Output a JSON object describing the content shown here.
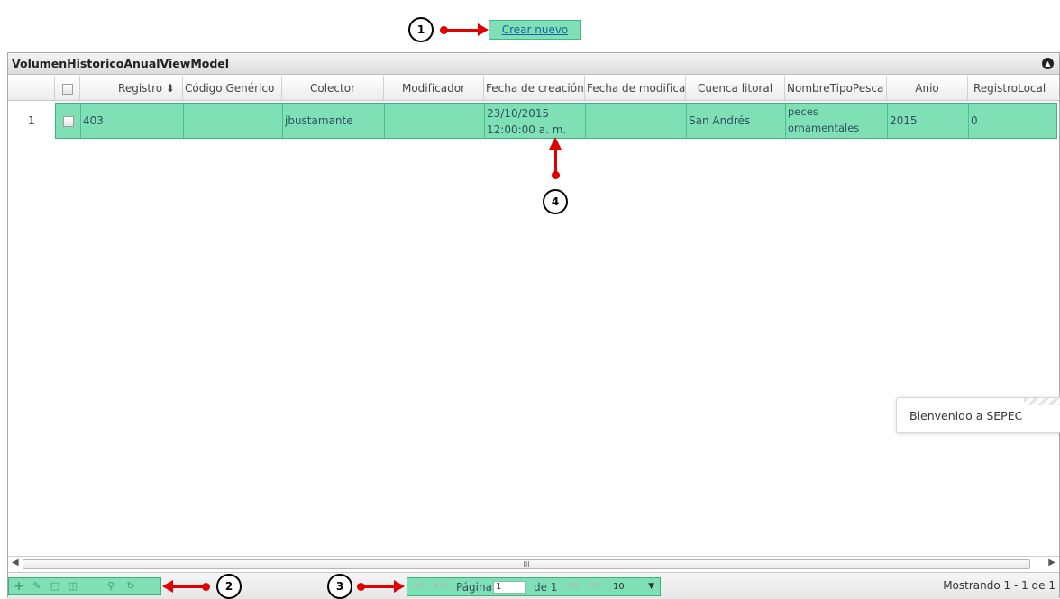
{
  "toolbar": {
    "create_label": "Crear nuevo"
  },
  "grid": {
    "title": "VolumenHistoricoAnualViewModel",
    "columns": [
      "Registro ⬍",
      "Código Genérico",
      "Colector",
      "Modificador",
      "Fecha de creación",
      "Fecha de modificación",
      "Cuenca litoral",
      "NombreTipoPesca",
      "Anio",
      "RegistroLocal"
    ],
    "rows": [
      {
        "num": "1",
        "registro": "403",
        "codigo": "",
        "colector": "jbustamante",
        "modificador": "",
        "fecha_creacion_1": "23/10/2015",
        "fecha_creacion_2": "12:00:00 a. m.",
        "fecha_modificacion": "",
        "cuenca": "San Andrés",
        "tipo_pesca_1": "peces",
        "tipo_pesca_2": "ornamentales",
        "anio": "2015",
        "registro_local": "0"
      }
    ],
    "scroll_label": "III"
  },
  "pager": {
    "page_label": "Página",
    "page_value": "1",
    "of_label": "de 1",
    "page_size": "10",
    "summary": "Mostrando 1 - 1 de 1"
  },
  "toast": {
    "message": "Bienvenido a SEPEC"
  },
  "callouts": {
    "c1": "1",
    "c2": "2",
    "c3": "3",
    "c4": "4"
  },
  "colors": {
    "highlight": "#7fe0b6",
    "annotation": "#e00000",
    "link": "#1a5fa8"
  }
}
